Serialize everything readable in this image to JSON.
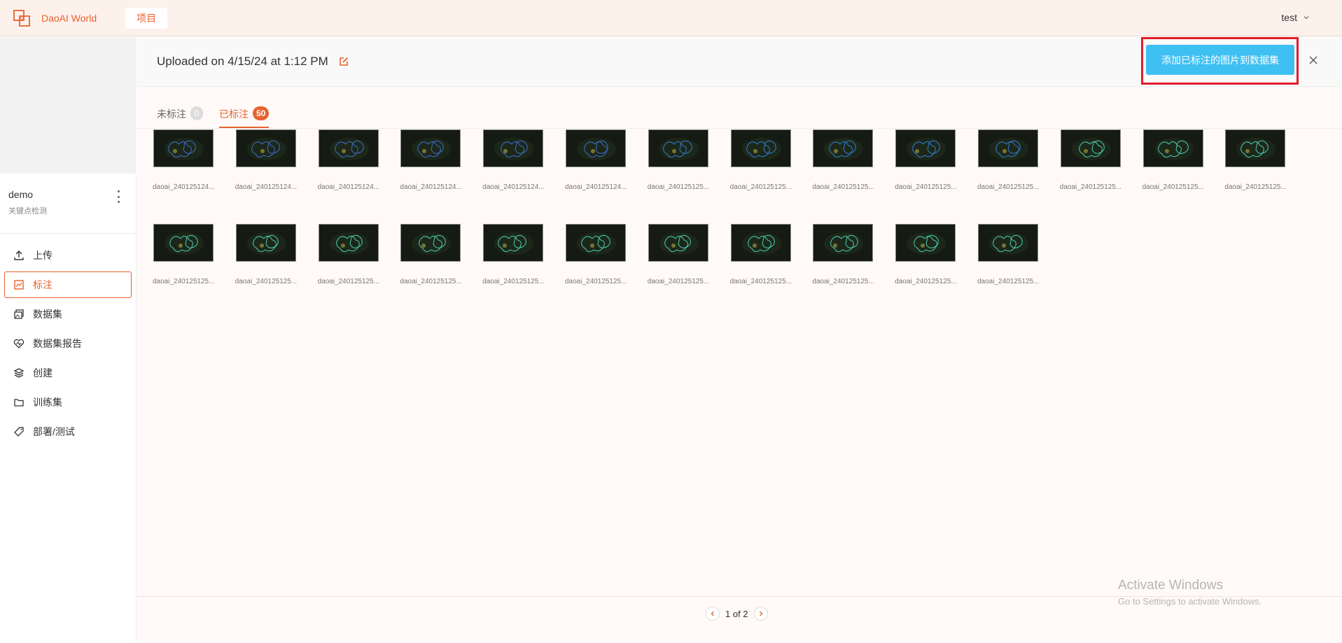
{
  "app": {
    "name": "DaoAI World",
    "nav_tab": "项目",
    "user": "test"
  },
  "project": {
    "name": "demo",
    "type": "关键点检测"
  },
  "sidebar": {
    "items": [
      {
        "label": "上传",
        "icon": "upload-icon",
        "active": false
      },
      {
        "label": "标注",
        "icon": "annotate-icon",
        "active": true
      },
      {
        "label": "数据集",
        "icon": "image-stack-icon",
        "active": false
      },
      {
        "label": "数据集报告",
        "icon": "heart-pulse-icon",
        "active": false
      },
      {
        "label": "创建",
        "icon": "layers-icon",
        "active": false
      },
      {
        "label": "训练集",
        "icon": "folder-icon",
        "active": false
      },
      {
        "label": "部署/测试",
        "icon": "tag-icon",
        "active": false
      }
    ]
  },
  "header": {
    "title": "Uploaded on 4/15/24 at 1:12 PM",
    "add_button": "添加已标注的图片到数据集"
  },
  "tabs": [
    {
      "label": "未标注",
      "count": "0",
      "active": false
    },
    {
      "label": "已标注",
      "count": "50",
      "active": true
    }
  ],
  "images": [
    {
      "caption": "daoai_240125124..."
    },
    {
      "caption": "daoai_240125124..."
    },
    {
      "caption": "daoai_240125124..."
    },
    {
      "caption": "daoai_240125124..."
    },
    {
      "caption": "daoai_240125124..."
    },
    {
      "caption": "daoai_240125124..."
    },
    {
      "caption": "daoai_240125125..."
    },
    {
      "caption": "daoai_240125125..."
    },
    {
      "caption": "daoai_240125125..."
    },
    {
      "caption": "daoai_240125125..."
    },
    {
      "caption": "daoai_240125125..."
    },
    {
      "caption": "daoai_240125125..."
    },
    {
      "caption": "daoai_240125125..."
    },
    {
      "caption": "daoai_240125125..."
    },
    {
      "caption": "daoai_240125125..."
    },
    {
      "caption": "daoai_240125125..."
    },
    {
      "caption": "daoai_240125125..."
    },
    {
      "caption": "daoai_240125125..."
    },
    {
      "caption": "daoai_240125125..."
    },
    {
      "caption": "daoai_240125125..."
    },
    {
      "caption": "daoai_240125125..."
    },
    {
      "caption": "daoai_240125125..."
    },
    {
      "caption": "daoai_240125125..."
    },
    {
      "caption": "daoai_240125125..."
    },
    {
      "caption": "daoai_240125125..."
    }
  ],
  "pagination": {
    "text": "1 of 2"
  },
  "watermark": {
    "title": "Activate Windows",
    "subtitle": "Go to Settings to activate Windows."
  },
  "colors": {
    "accent": "#e8622e",
    "button": "#3fc0f2",
    "highlight": "#e11d2a"
  }
}
